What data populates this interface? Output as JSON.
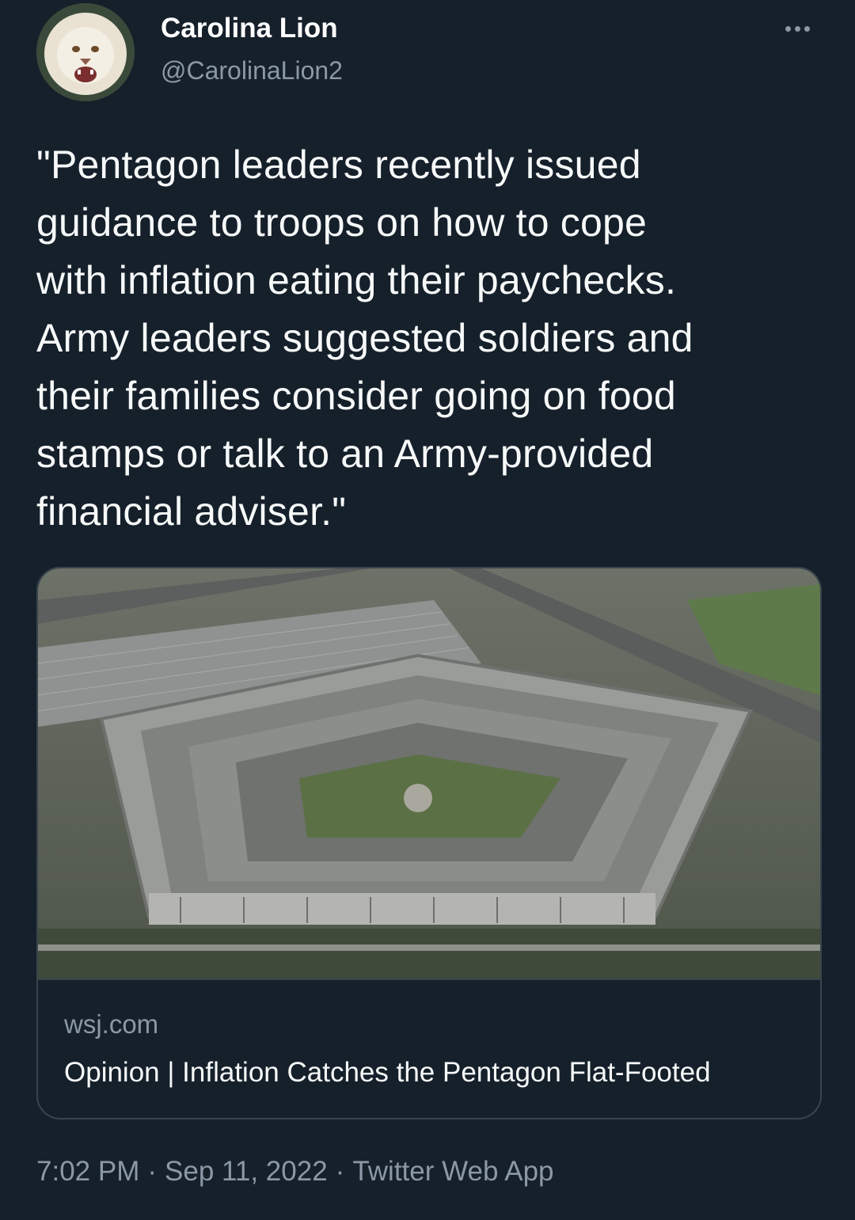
{
  "author": {
    "name": "Carolina Lion",
    "handle": "@CarolinaLion2",
    "avatar_icon": "lion-avatar"
  },
  "more_icon": "more-horizontal-icon",
  "tweet": {
    "text": "\"Pentagon leaders recently issued\nguidance to troops on how to cope\nwith inflation eating their paychecks.\nArmy leaders suggested soldiers and\ntheir families consider going on food\nstamps or talk to an Army-provided\nfinancial adviser.\""
  },
  "link_card": {
    "image": "pentagon-aerial-photo",
    "domain": "wsj.com",
    "title": "Opinion | Inflation Catches the Pentagon Flat-Footed"
  },
  "meta": {
    "time": "7:02 PM",
    "separator": "·",
    "date": "Sep 11, 2022",
    "source": "Twitter Web App"
  },
  "colors": {
    "background": "#15202b",
    "text_primary": "#f7f9f9",
    "text_secondary": "#8b98a5",
    "border": "#38444d"
  }
}
